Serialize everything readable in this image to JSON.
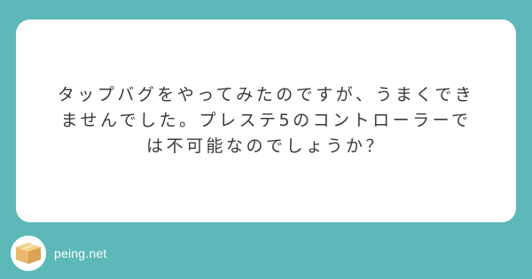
{
  "question": {
    "text": "タップバグをやってみたのですが、うまくでき\nませんでした。プレステ5のコントローラーで\nは不可能なのでしょうか？"
  },
  "footer": {
    "site_name": "peing.net",
    "logo_icon": "box-icon"
  },
  "colors": {
    "background": "#5cb9b8",
    "card": "#ffffff",
    "text": "#3a3a3a",
    "box": "#e8b86b"
  }
}
